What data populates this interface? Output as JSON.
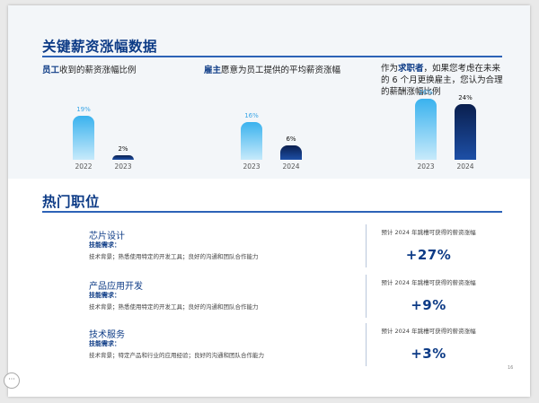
{
  "section1": {
    "title": "关键薪资涨幅数据"
  },
  "chart_data": [
    {
      "type": "bar",
      "label_prefix_bold": "员工",
      "label_rest": "收到的薪资涨幅比例",
      "categories": [
        "2022",
        "2023"
      ],
      "values": [
        19,
        2
      ],
      "value_labels": [
        "19%",
        "2%"
      ]
    },
    {
      "type": "bar",
      "label_prefix_bold": "雇主",
      "label_rest": "愿意为员工提供的平均薪资涨幅",
      "categories": [
        "2023",
        "2024"
      ],
      "values": [
        16,
        6
      ],
      "value_labels": [
        "16%",
        "6%"
      ]
    },
    {
      "type": "bar",
      "label_pre": "作为",
      "label_bold": "求职者",
      "label_rest": "，如果您考虑在未来的 6 个月更换雇主，您认为合理的薪酬涨幅比例",
      "categories": [
        "2023",
        "2024"
      ],
      "values": [
        26,
        24
      ],
      "value_labels": [
        "26%",
        "24%"
      ]
    }
  ],
  "section2": {
    "title": "热门职位",
    "jobs": [
      {
        "title": "芯片设计",
        "req_label": "技能需求：",
        "desc": "技术背景；熟悉使用特定的开发工具；良好的沟通和团队合作能力",
        "pred": "预计 2024 年跳槽可获得的薪资涨幅",
        "pct": "+27%"
      },
      {
        "title": "产品应用开发",
        "req_label": "技能需求：",
        "desc": "技术背景；熟悉使用特定的开发工具；良好的沟通和团队合作能力",
        "pred": "预计 2024 年跳槽可获得的薪资涨幅",
        "pct": "+9%"
      },
      {
        "title": "技术服务",
        "req_label": "技能需求：",
        "desc": "技术背景；特定产品和行业的应用经验；良好的沟通和团队合作能力",
        "pred": "预计 2024 年跳槽可获得的薪资涨幅",
        "pct": "+3%"
      }
    ]
  },
  "page_number": "16",
  "nav_icon": "ellipsis-icon",
  "nav_label": "···",
  "colors": {
    "primary": "#0d3b86",
    "bar_light": "#3ab2ee",
    "bar_dark": "#0a1f4e"
  }
}
